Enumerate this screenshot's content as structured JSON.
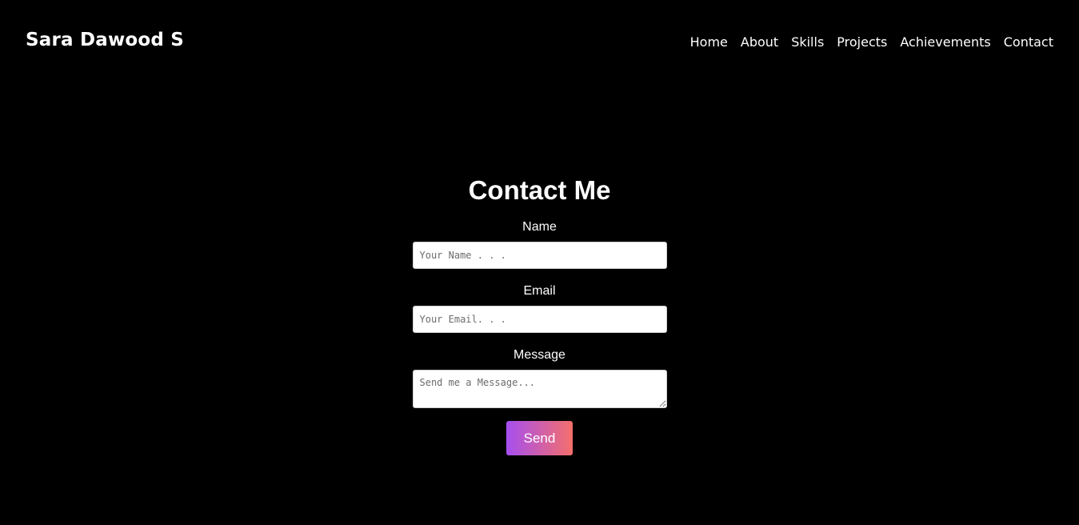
{
  "header": {
    "brand": "Sara Dawood S",
    "nav": [
      {
        "label": "Home"
      },
      {
        "label": "About"
      },
      {
        "label": "Skills"
      },
      {
        "label": "Projects"
      },
      {
        "label": "Achievements"
      },
      {
        "label": "Contact"
      }
    ]
  },
  "contact": {
    "title": "Contact Me",
    "name_label": "Name",
    "name_placeholder": "Your Name . . .",
    "email_label": "Email",
    "email_placeholder": "Your Email. . .",
    "message_label": "Message",
    "message_placeholder": "Send me a Message...",
    "send_label": "Send"
  },
  "colors": {
    "background": "#000000",
    "text": "#ffffff",
    "button_gradient_start": "#a64ff0",
    "button_gradient_end": "#f46f6b"
  }
}
